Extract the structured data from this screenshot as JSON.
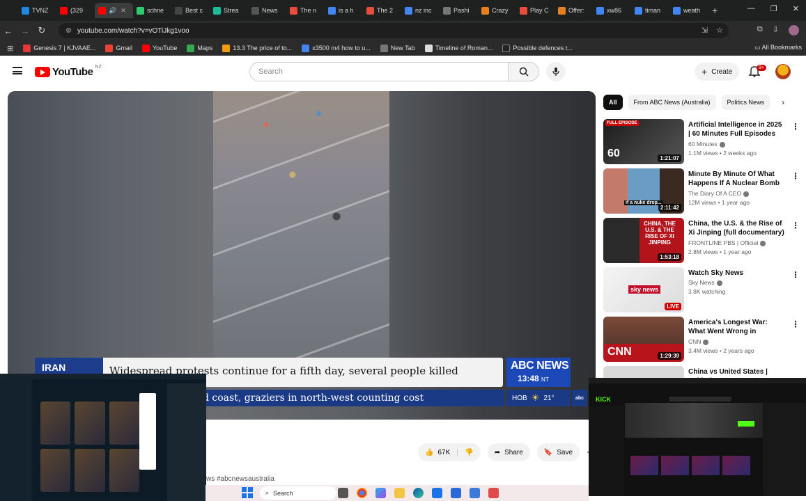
{
  "browser": {
    "tabs": [
      {
        "label": "TVNZ",
        "color": "#1e88e5"
      },
      {
        "label": "(329",
        "color": "#ff0000"
      },
      {
        "label": "",
        "color": "#ff0000",
        "active": true
      },
      {
        "label": "schne",
        "color": "#2ecc71"
      },
      {
        "label": "Best c",
        "color": "#444444"
      },
      {
        "label": "Strea",
        "color": "#1abc9c"
      },
      {
        "label": "News",
        "color": "#555555"
      },
      {
        "label": "The n",
        "color": "#e74c3c"
      },
      {
        "label": "is a h",
        "color": "#4285f4"
      },
      {
        "label": "The 2",
        "color": "#e74c3c"
      },
      {
        "label": "nz inc",
        "color": "#4285f4"
      },
      {
        "label": "Pashi",
        "color": "#777777"
      },
      {
        "label": "Crazy",
        "color": "#e67e22"
      },
      {
        "label": "Play C",
        "color": "#e74c3c"
      },
      {
        "label": "Offer:",
        "color": "#e67e22"
      },
      {
        "label": "xw86",
        "color": "#4285f4"
      },
      {
        "label": "timan",
        "color": "#4285f4"
      },
      {
        "label": "weath",
        "color": "#4285f4"
      }
    ],
    "url": "youtube.com/watch?v=vOTiJkg1voo",
    "bookmarks": [
      {
        "label": "Genesis 7 | KJVAAE...",
        "color": "#e53935"
      },
      {
        "label": "Gmail",
        "color": "#ea4335"
      },
      {
        "label": "YouTube",
        "color": "#ff0000"
      },
      {
        "label": "Maps",
        "color": "#34a853"
      },
      {
        "label": "13.3 The price of to...",
        "color": "#f39c12"
      },
      {
        "label": "x3500 m4 how to u...",
        "color": "#4285f4"
      },
      {
        "label": "New Tab",
        "color": "#777777"
      },
      {
        "label": "Timeline of Roman...",
        "color": "#dddddd"
      },
      {
        "label": "Possible defences t...",
        "color": "#222222"
      }
    ],
    "all_bookmarks": "All Bookmarks"
  },
  "youtube": {
    "logo_text": "YouTube",
    "region": "NZ",
    "search_placeholder": "Search",
    "create_label": "Create",
    "notification_count": "9+",
    "video": {
      "lower_third_tag": "IRAN",
      "headline": "Widespread protests continue for a fifth day, several people killed",
      "ticker": "d coast, graziers in north-west counting cost",
      "network": "ABC NEWS",
      "time": "13:48",
      "timezone": "NT",
      "weather_city": "НОВ",
      "temperature": "21°"
    },
    "actions": {
      "likes": "67K",
      "share": "Share",
      "save": "Save"
    },
    "hashtag_partial": "ws #abcnewsaustralia",
    "chips": [
      "All",
      "From ABC News (Australia)",
      "Politics News"
    ],
    "recommendations": [
      {
        "title": "Artificial Intelligence in 2025 | 60 Minutes Full Episodes",
        "channel": "60 Minutes",
        "meta": "1.1M views • 2 weeks ago",
        "duration": "1:21:07",
        "thumb_label": "FULL EPISODE"
      },
      {
        "title": "Minute By Minute Of What Happens If A Nuclear Bomb ...",
        "channel": "The Diary Of A CEO",
        "meta": "12M views • 1 year ago",
        "duration": "2:11:42",
        "thumb_label": "if a nuke drop..."
      },
      {
        "title": "China, the U.S. & the Rise of Xi Jinping (full documentary) | ...",
        "channel": "FRONTLINE PBS | Official",
        "meta": "2.8M views • 1 year ago",
        "duration": "1:53:18",
        "thumb_label": "CHINA, THE U.S. & THE RISE OF XI JINPING"
      },
      {
        "title": "Watch Sky News",
        "channel": "Sky News",
        "meta": "3.8K watching",
        "duration": "LIVE",
        "thumb_label": "sky news"
      },
      {
        "title": "America's Longest War: What Went Wrong in Afghanistan ...",
        "channel": "CNN",
        "meta": "3.4M views • 2 years ago",
        "duration": "1:29:39",
        "thumb_label": "CNN"
      },
      {
        "title": "China vs United States | Behind",
        "channel": "",
        "meta": "",
        "duration": "",
        "thumb_label": ""
      }
    ]
  },
  "taskbar": {
    "search_placeholder": "Search"
  },
  "overlays": {
    "right_brand": "KICK"
  }
}
